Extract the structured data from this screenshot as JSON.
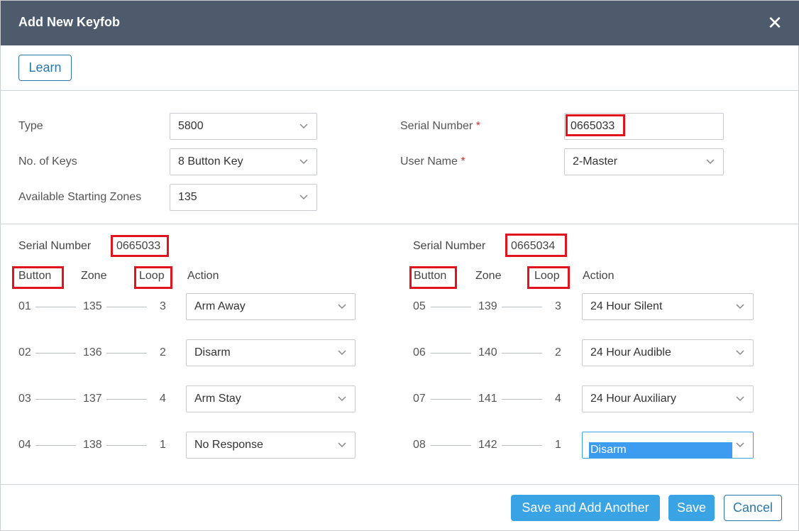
{
  "dialog": {
    "title": "Add New Keyfob",
    "close_icon": "close-icon",
    "learn_label": "Learn"
  },
  "form": {
    "type_label": "Type",
    "type_value": "5800",
    "keys_label": "No. of Keys",
    "keys_value": "8 Button Key",
    "zones_label": "Available Starting Zones",
    "zones_value": "135",
    "serial_label": "Serial Number",
    "serial_value": "0665033",
    "username_label": "User Name",
    "username_value": "2-Master",
    "required_mark": "*"
  },
  "left": {
    "serial_label": "Serial Number",
    "serial_value": "0665033",
    "col_button": "Button",
    "col_zone": "Zone",
    "col_loop": "Loop",
    "col_action": "Action",
    "rows": [
      {
        "button": "01",
        "zone": "135",
        "loop": "3",
        "action": "Arm Away"
      },
      {
        "button": "02",
        "zone": "136",
        "loop": "2",
        "action": "Disarm"
      },
      {
        "button": "03",
        "zone": "137",
        "loop": "4",
        "action": "Arm Stay"
      },
      {
        "button": "04",
        "zone": "138",
        "loop": "1",
        "action": "No Response"
      }
    ]
  },
  "right": {
    "serial_label": "Serial Number",
    "serial_value": "0665034",
    "col_button": "Button",
    "col_zone": "Zone",
    "col_loop": "Loop",
    "col_action": "Action",
    "rows": [
      {
        "button": "05",
        "zone": "139",
        "loop": "3",
        "action": "24 Hour Silent"
      },
      {
        "button": "06",
        "zone": "140",
        "loop": "2",
        "action": "24 Hour Audible"
      },
      {
        "button": "07",
        "zone": "141",
        "loop": "4",
        "action": "24 Hour Auxiliary"
      },
      {
        "button": "08",
        "zone": "142",
        "loop": "1",
        "action": "Disarm"
      }
    ]
  },
  "footer": {
    "save_add_label": "Save and Add Another",
    "save_label": "Save",
    "cancel_label": "Cancel"
  },
  "colors": {
    "header_bg": "#4d5b6c",
    "primary": "#3aa3e3",
    "outline": "#2b78a8",
    "highlight": "#e0141e"
  }
}
